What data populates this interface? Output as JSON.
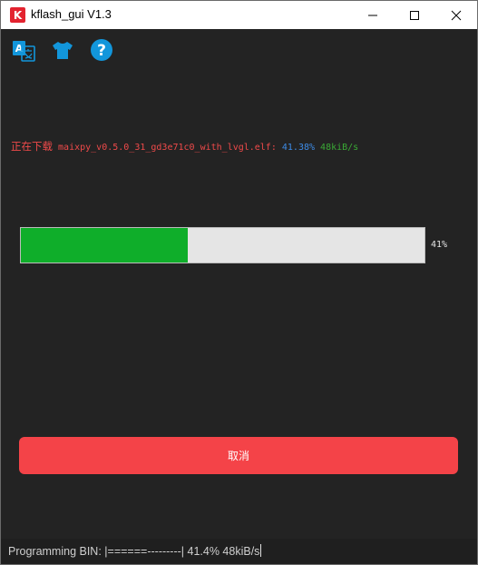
{
  "window": {
    "title": "kflash_gui V1.3",
    "app_icon_letter": "K",
    "controls": {
      "minimize": "—",
      "maximize": "☐",
      "close": "✕"
    }
  },
  "toolbar": {
    "icons": [
      "translate-icon",
      "tshirt-icon",
      "help-icon"
    ],
    "help_glyph": "?",
    "translate_glyph": "A",
    "accent_color": "#1296db"
  },
  "status": {
    "prefix": "正在下载",
    "filename": "maixpy_v0.5.0_31_gd3e71c0_with_lvgl.elf:",
    "percent": "41.38%",
    "speed": "48kiB/s"
  },
  "progress": {
    "value": 0.4138,
    "label": "41%",
    "fill_color": "#0fae2a"
  },
  "cancel_button": {
    "label": "取消",
    "color": "#f44348"
  },
  "statusbar": {
    "text": "Programming BIN: |======---------| 41.4% 48kiB/s"
  }
}
